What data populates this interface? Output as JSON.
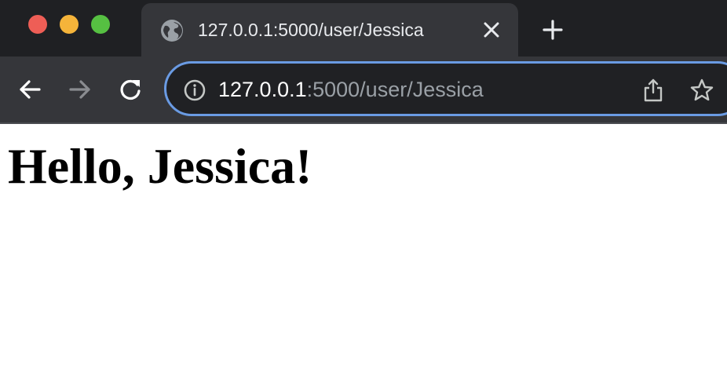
{
  "window": {
    "controls": [
      "close",
      "minimize",
      "zoom"
    ]
  },
  "tab": {
    "title": "127.0.0.1:5000/user/Jessica",
    "favicon": "globe-icon",
    "close_icon": "close-icon"
  },
  "toolbar": {
    "new_tab_icon": "plus-icon",
    "back_icon": "arrow-left-icon",
    "forward_icon": "arrow-right-icon",
    "reload_icon": "reload-icon"
  },
  "omnibox": {
    "info_icon": "info-icon",
    "url_host": "127.0.0.1",
    "url_rest": ":5000/user/Jessica",
    "share_icon": "share-icon",
    "bookmark_icon": "star-icon"
  },
  "page": {
    "heading": "Hello, Jessica!"
  },
  "colors": {
    "tabstrip_bg": "#1f2023",
    "toolbar_bg": "#35363a",
    "omnibox_bg": "#202124",
    "omnibox_focus_ring": "#6a9be3",
    "traffic_red": "#ee5e56",
    "traffic_yellow": "#f5b43a",
    "traffic_green": "#56c042"
  }
}
